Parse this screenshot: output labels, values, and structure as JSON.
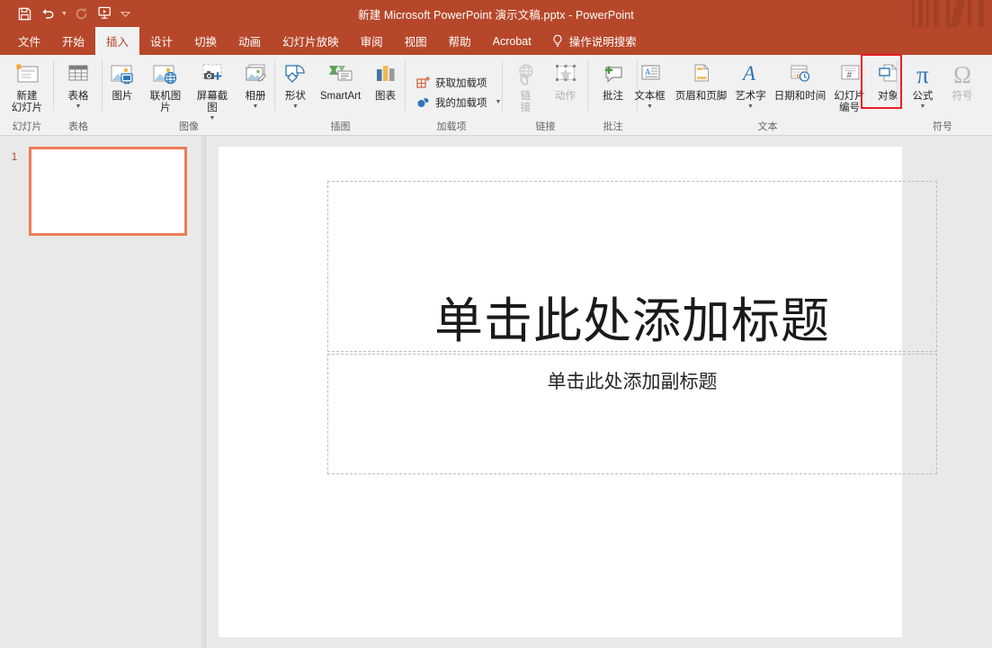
{
  "window": {
    "title": "新建 Microsoft PowerPoint 演示文稿.pptx  -  PowerPoint",
    "accent_color": "#b7472a",
    "ribbon_bg": "#f1f1f1",
    "highlight_color": "#ee1c25"
  },
  "quick_access": {
    "items": [
      {
        "name": "save-icon",
        "label": "保存"
      },
      {
        "name": "undo-icon",
        "label": "撤消"
      },
      {
        "name": "redo-icon",
        "label": "恢复"
      },
      {
        "name": "start-slideshow-icon",
        "label": "从头开始"
      },
      {
        "name": "customize-qat-icon",
        "label": "自定义快速访问工具栏"
      }
    ]
  },
  "tabs": [
    {
      "label": "文件",
      "active": false
    },
    {
      "label": "开始",
      "active": false
    },
    {
      "label": "插入",
      "active": true
    },
    {
      "label": "设计",
      "active": false
    },
    {
      "label": "切换",
      "active": false
    },
    {
      "label": "动画",
      "active": false
    },
    {
      "label": "幻灯片放映",
      "active": false
    },
    {
      "label": "审阅",
      "active": false
    },
    {
      "label": "视图",
      "active": false
    },
    {
      "label": "帮助",
      "active": false
    },
    {
      "label": "Acrobat",
      "active": false
    }
  ],
  "tell_me": {
    "label": "操作说明搜索",
    "icon": "lightbulb-icon"
  },
  "ribbon": {
    "groups": [
      {
        "label": "幻灯片",
        "buttons": [
          {
            "label": "新建\n幻灯片",
            "icon": "new-slide-icon",
            "dropdown": "inline",
            "disabled": false
          }
        ]
      },
      {
        "label": "表格",
        "buttons": [
          {
            "label": "表格",
            "icon": "table-icon",
            "dropdown": "below",
            "disabled": false
          }
        ]
      },
      {
        "label": "图像",
        "buttons": [
          {
            "label": "图片",
            "icon": "picture-icon",
            "dropdown": "none",
            "disabled": false
          },
          {
            "label": "联机图片",
            "icon": "online-picture-icon",
            "dropdown": "none",
            "disabled": false
          },
          {
            "label": "屏幕截图",
            "icon": "screenshot-icon",
            "dropdown": "below",
            "disabled": false
          },
          {
            "label": "相册",
            "icon": "photo-album-icon",
            "dropdown": "below",
            "disabled": false
          }
        ]
      },
      {
        "label": "插图",
        "buttons": [
          {
            "label": "形状",
            "icon": "shapes-icon",
            "dropdown": "below",
            "disabled": false
          },
          {
            "label": "SmartArt",
            "icon": "smartart-icon",
            "dropdown": "none",
            "disabled": false
          },
          {
            "label": "图表",
            "icon": "chart-icon",
            "dropdown": "none",
            "disabled": false
          }
        ]
      },
      {
        "label": "加载项",
        "small_buttons": [
          {
            "label": "获取加载项",
            "icon": "get-addins-icon",
            "dropdown": "none",
            "disabled": false
          },
          {
            "label": "我的加载项",
            "icon": "my-addins-icon",
            "dropdown": "right",
            "disabled": false
          }
        ]
      },
      {
        "label": "链接",
        "buttons": [
          {
            "label": "链\n接",
            "icon": "link-icon",
            "dropdown": "none",
            "disabled": true
          },
          {
            "label": "动作",
            "icon": "action-icon",
            "dropdown": "none",
            "disabled": true
          }
        ]
      },
      {
        "label": "批注",
        "buttons": [
          {
            "label": "批注",
            "icon": "comment-icon",
            "dropdown": "none",
            "disabled": false
          }
        ]
      },
      {
        "label": "文本",
        "buttons": [
          {
            "label": "文本框",
            "icon": "textbox-icon",
            "dropdown": "below",
            "disabled": false
          },
          {
            "label": "页眉和页脚",
            "icon": "header-footer-icon",
            "dropdown": "none",
            "disabled": false
          },
          {
            "label": "艺术字",
            "icon": "wordart-icon",
            "dropdown": "below",
            "disabled": false
          },
          {
            "label": "日期和时间",
            "icon": "date-time-icon",
            "dropdown": "none",
            "disabled": false
          },
          {
            "label": "幻灯片\n编号",
            "icon": "slide-number-icon",
            "dropdown": "none",
            "disabled": false
          },
          {
            "label": "对象",
            "icon": "object-icon",
            "dropdown": "none",
            "disabled": false,
            "highlighted": true
          }
        ]
      },
      {
        "label": "符号",
        "buttons": [
          {
            "label": "公式",
            "icon": "equation-icon",
            "glyph": "π",
            "dropdown": "below",
            "disabled": false
          },
          {
            "label": "符号",
            "icon": "symbol-icon",
            "glyph": "Ω",
            "dropdown": "none",
            "disabled": true
          }
        ]
      }
    ]
  },
  "slide_panel": {
    "slides": [
      {
        "number": "1",
        "selected": true
      }
    ]
  },
  "slide": {
    "title_placeholder": "单击此处添加标题",
    "subtitle_placeholder": "单击此处添加副标题"
  }
}
